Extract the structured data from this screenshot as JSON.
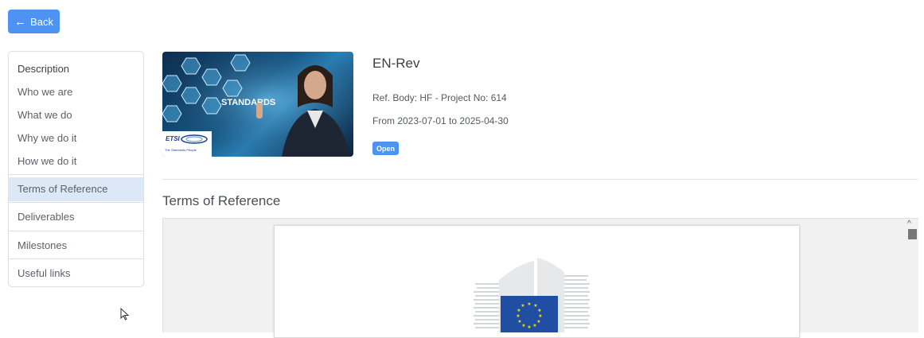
{
  "back_button": {
    "label": "Back"
  },
  "sidebar": {
    "items": [
      {
        "label": "Description"
      },
      {
        "label": "Who we are"
      },
      {
        "label": "What we do"
      },
      {
        "label": "Why we do it"
      },
      {
        "label": "How we do it"
      },
      {
        "label": "Terms of Reference",
        "active": true
      },
      {
        "label": "Deliverables"
      },
      {
        "label": "Milestones"
      },
      {
        "label": "Useful links"
      }
    ]
  },
  "project": {
    "banner": {
      "overlay_text": "STANDARDS",
      "logo_text": "ETSI",
      "logo_tagline": "The Standards People"
    },
    "name": "EN-Rev",
    "ref_body": "Ref. Body: HF - Project No: 614",
    "dates": "From 2023-07-01 to 2025-04-30",
    "status": "Open"
  },
  "section": {
    "title": "Terms of Reference"
  },
  "colors": {
    "accent": "#4d94f2",
    "active_bg": "#dde8f7",
    "eu_blue": "#1f4ea3",
    "eu_star": "#ffdd00"
  }
}
